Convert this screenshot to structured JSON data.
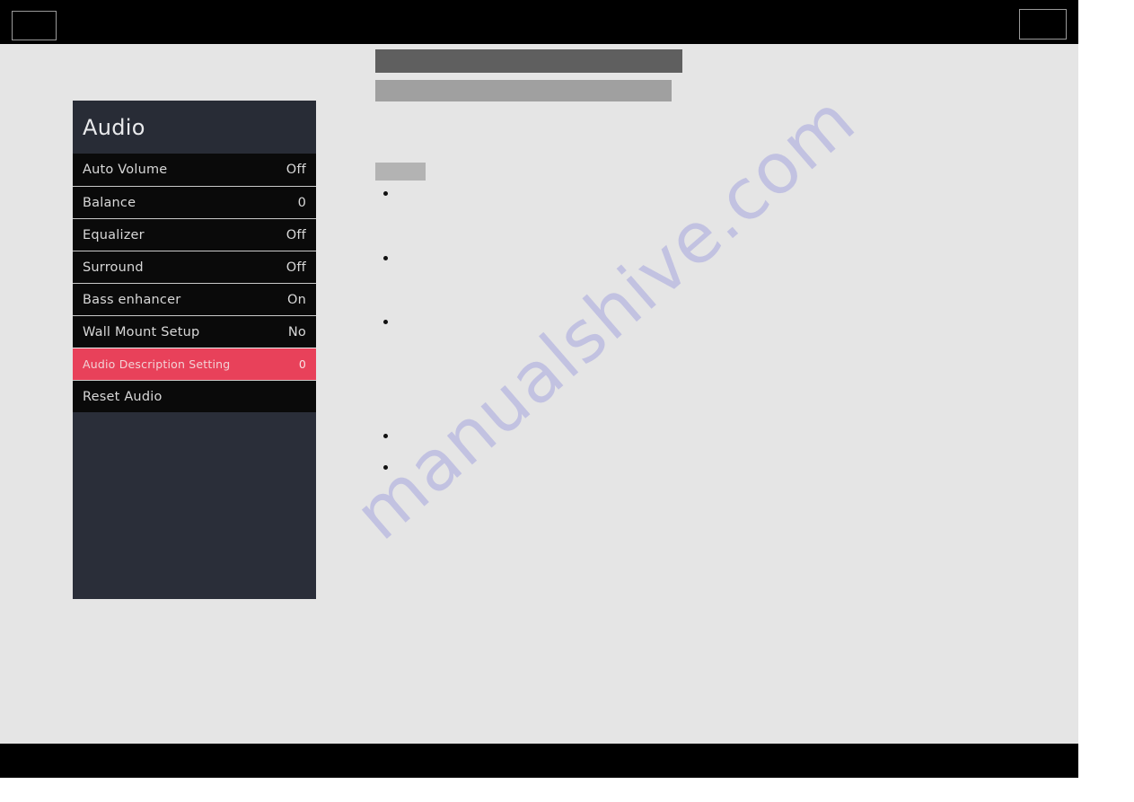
{
  "page": {
    "background_color": "#e5e5e5",
    "band_color": "#000000",
    "watermark": "manualshive.com",
    "watermark_color": "#b9b9e0"
  },
  "header_band": {
    "left_box_label": "",
    "right_box_label": ""
  },
  "tv_menu": {
    "title": "Audio",
    "accent_color": "#e8415a",
    "header_bg": "#282c36",
    "panel_bg": "#2a2e39",
    "row_bg": "#0a0a0a",
    "items": [
      {
        "label": "Auto Volume",
        "value": "Off",
        "selected": false
      },
      {
        "label": "Balance",
        "value": "0",
        "selected": false
      },
      {
        "label": "Equalizer",
        "value": "Off",
        "selected": false
      },
      {
        "label": "Surround",
        "value": "Off",
        "selected": false
      },
      {
        "label": "Bass enhancer",
        "value": "On",
        "selected": false
      },
      {
        "label": "Wall Mount Setup",
        "value": "No",
        "selected": false
      },
      {
        "label": "Audio Description Setting",
        "value": "0",
        "selected": true
      },
      {
        "label": "Reset Audio",
        "value": "",
        "selected": false
      }
    ]
  },
  "content": {
    "title_block": "",
    "subtitle_block": "",
    "section_block": "",
    "bullets": [
      "",
      "",
      "",
      "",
      ""
    ]
  }
}
